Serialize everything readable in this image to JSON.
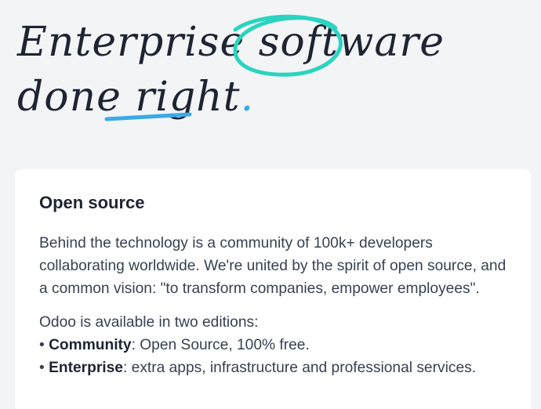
{
  "hero": {
    "line1_a": "Enterprise ",
    "line1_b": "software",
    "line2_a": "done ",
    "line2_b": "right",
    "line2_dot": ".",
    "colors": {
      "circle": "#2ad4c0",
      "underline": "#3aa9e8",
      "dot": "#3aa9e8",
      "text": "#1f2433"
    }
  },
  "card": {
    "title": "Open source",
    "paragraph": "Behind the technology is a community of 100k+ developers collaborating worldwide. We're united by the spirit of open source, and a common vision: \"to transform companies, empower employees\".",
    "editions_intro": "Odoo is available in two editions:",
    "editions": [
      {
        "bullet": "• ",
        "name": "Community",
        "desc": ": Open Source, 100% free."
      },
      {
        "bullet": "• ",
        "name": "Enterprise",
        "desc": ": extra apps, infrastructure and professional services."
      }
    ]
  }
}
